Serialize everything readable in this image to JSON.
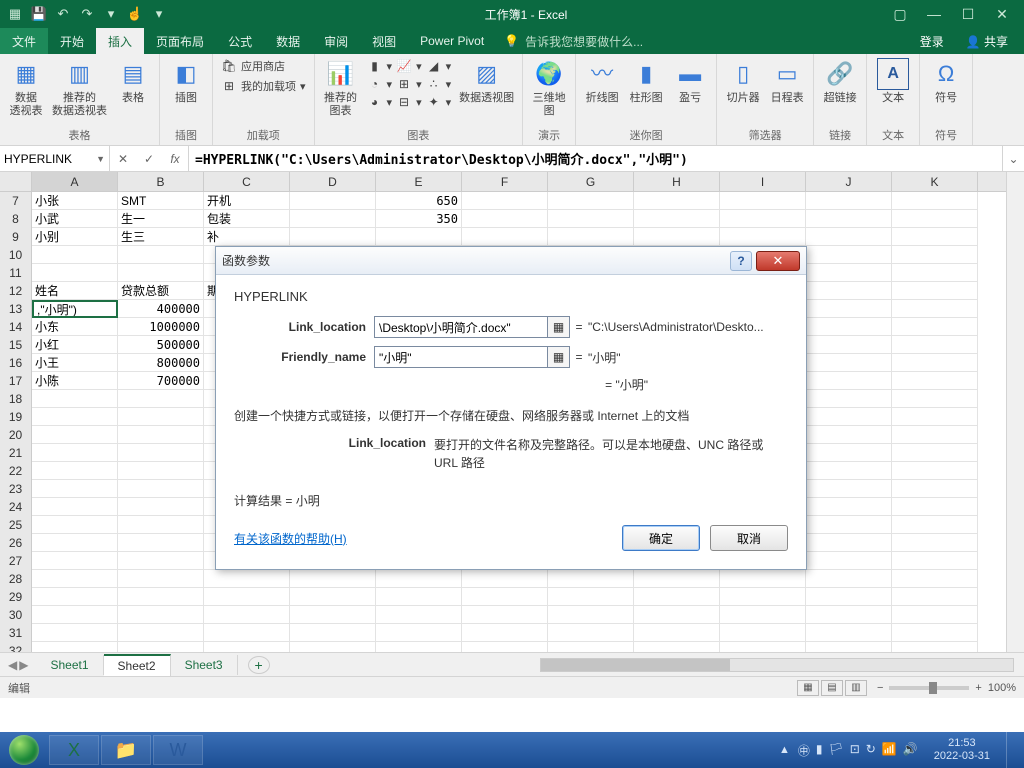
{
  "titlebar": {
    "title": "工作簿1 - Excel"
  },
  "tabs": {
    "file": "文件",
    "items": [
      "开始",
      "插入",
      "页面布局",
      "公式",
      "数据",
      "审阅",
      "视图",
      "Power Pivot"
    ],
    "active": "插入",
    "tell_placeholder": "告诉我您想要做什么...",
    "login": "登录",
    "share": "共享"
  },
  "ribbon": {
    "groups": {
      "tables": {
        "label": "表格",
        "pivot": "数据\n透视表",
        "recpivot": "推荐的\n数据透视表",
        "table": "表格"
      },
      "illus": {
        "label": "插图",
        "btn": "插图"
      },
      "addins": {
        "label": "加载项",
        "store": "应用商店",
        "myaddins": "我的加载项"
      },
      "charts": {
        "label": "图表",
        "rec": "推荐的\n图表",
        "pivotchart": "数据透视图"
      },
      "threed": {
        "label": "演示",
        "btn": "三维地\n图"
      },
      "spark": {
        "label": "迷你图",
        "line": "折线图",
        "col": "柱形图",
        "winloss": "盈亏"
      },
      "filter": {
        "label": "筛选器",
        "slicer": "切片器",
        "timeline": "日程表"
      },
      "links": {
        "label": "链接",
        "hyperlink": "超链接"
      },
      "text": {
        "label": "文本",
        "btn": "文本"
      },
      "sym": {
        "label": "符号",
        "btn": "符号"
      }
    }
  },
  "fxbar": {
    "namebox": "HYPERLINK",
    "fx": "fx",
    "formula": "=HYPERLINK(\"C:\\Users\\Administrator\\Desktop\\小明简介.docx\",\"小明\")"
  },
  "columns": [
    "A",
    "B",
    "C",
    "D",
    "E",
    "F",
    "G",
    "H",
    "I",
    "J",
    "K"
  ],
  "rows": [
    {
      "n": 7,
      "A": "小张",
      "B": "SMT",
      "C": "开机",
      "E": "650"
    },
    {
      "n": 8,
      "A": "小武",
      "B": "生一",
      "C": "包装",
      "E": "350"
    },
    {
      "n": 9,
      "A": "小别",
      "B": "生三",
      "C": "补"
    },
    {
      "n": 10
    },
    {
      "n": 11
    },
    {
      "n": 12,
      "A": "姓名",
      "B": "贷款总额",
      "C": "期"
    },
    {
      "n": 13,
      "A": ",\"小明\")",
      "B": "400000"
    },
    {
      "n": 14,
      "A": "小东",
      "B": "1000000"
    },
    {
      "n": 15,
      "A": "小红",
      "B": "500000"
    },
    {
      "n": 16,
      "A": "小王",
      "B": "800000"
    },
    {
      "n": 17,
      "A": "小陈",
      "B": "700000"
    },
    {
      "n": 18
    },
    {
      "n": 19
    },
    {
      "n": 20
    },
    {
      "n": 21
    },
    {
      "n": 22
    },
    {
      "n": 23
    },
    {
      "n": 24
    },
    {
      "n": 25
    },
    {
      "n": 26
    },
    {
      "n": 27
    },
    {
      "n": 28
    },
    {
      "n": 29
    },
    {
      "n": 30
    },
    {
      "n": 31
    },
    {
      "n": 32
    }
  ],
  "dialog": {
    "title": "函数参数",
    "fname": "HYPERLINK",
    "p1_label": "Link_location",
    "p1_value": "\\Desktop\\小明简介.docx\"",
    "p1_eval": "\"C:\\Users\\Administrator\\Deskto...",
    "p2_label": "Friendly_name",
    "p2_value": "\"小明\"",
    "p2_eval": "\"小明\"",
    "res_preview": "= \"小明\"",
    "eq": "=",
    "desc": "创建一个快捷方式或链接，以便打开一个存储在硬盘、网络服务器或 Internet 上的文档",
    "pdesc_label": "Link_location",
    "pdesc_text": "要打开的文件名称及完整路径。可以是本地硬盘、UNC 路径或 URL 路径",
    "result_label": "计算结果 = ",
    "result_value": "小明",
    "help": "有关该函数的帮助(H)",
    "ok": "确定",
    "cancel": "取消"
  },
  "sheets": {
    "items": [
      "Sheet1",
      "Sheet2",
      "Sheet3"
    ],
    "active": "Sheet2"
  },
  "statusbar": {
    "mode": "编辑",
    "zoom": "100%"
  },
  "taskbar": {
    "time": "21:53",
    "date": "2022-03-31"
  }
}
